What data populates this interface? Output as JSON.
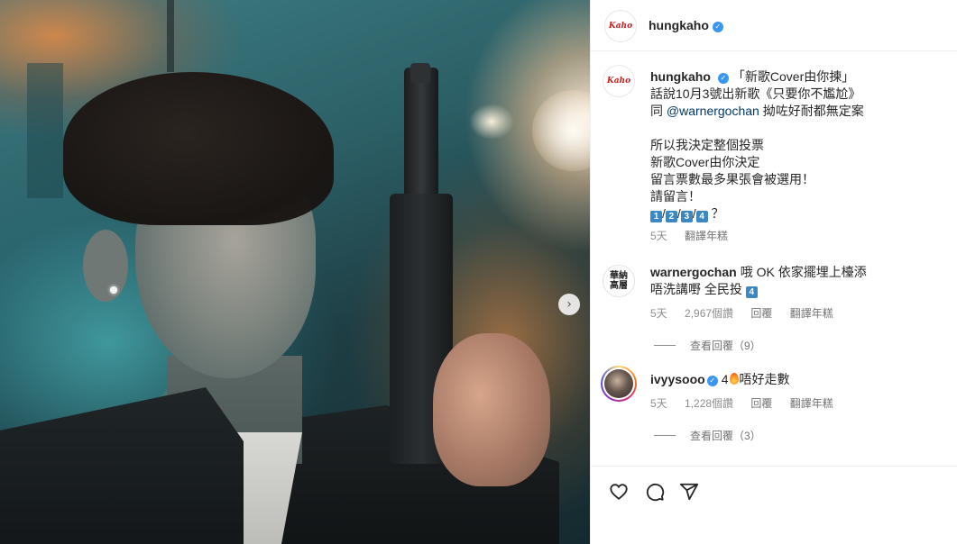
{
  "post": {
    "username": "hungkaho",
    "avatar_text": "Kaho",
    "carousel_next": "›"
  },
  "caption": {
    "username": "hungkaho",
    "line1": "「新歌Cover由你揀」",
    "line2": "話說10月3號出新歌《只要你不尷尬》",
    "line3_prefix": "同 ",
    "line3_mention": "@warnergochan",
    "line3_suffix": " 拗咗好耐都無定案",
    "line5": "所以我決定整個投票",
    "line6": "新歌Cover由你決定",
    "line7": "留言票數最多果張會被選用！",
    "line8": "請留言！",
    "options": [
      "1",
      "2",
      "3",
      "4"
    ],
    "separator": "/",
    "question": "？",
    "time": "5天",
    "translate": "翻譯年糕"
  },
  "comments": [
    {
      "username": "warnergochan",
      "avatar_text": "華納\n高層",
      "text_line1": "哦 OK 依家擺埋上檯添",
      "text_line2": "唔洗講嘢 全民投",
      "keycap": "4",
      "time": "5天",
      "likes": "2,967個讚",
      "reply": "回覆",
      "translate": "翻譯年糕",
      "view_replies": "查看回覆（9）"
    },
    {
      "username": "ivyysooo",
      "text_prefix": "4",
      "text_suffix": "唔好走數",
      "time": "5天",
      "likes": "1,228個讚",
      "reply": "回覆",
      "translate": "翻譯年糕",
      "view_replies": "查看回覆（3）"
    }
  ],
  "icons": [
    "heart-icon",
    "comment-icon",
    "share-icon",
    "verified-badge-icon",
    "chevron-right-icon"
  ],
  "colors": {
    "verified": "#3897f0",
    "mention": "#00376b",
    "keycap": "#3b88c3",
    "kaho_logo": "#c8201f"
  }
}
